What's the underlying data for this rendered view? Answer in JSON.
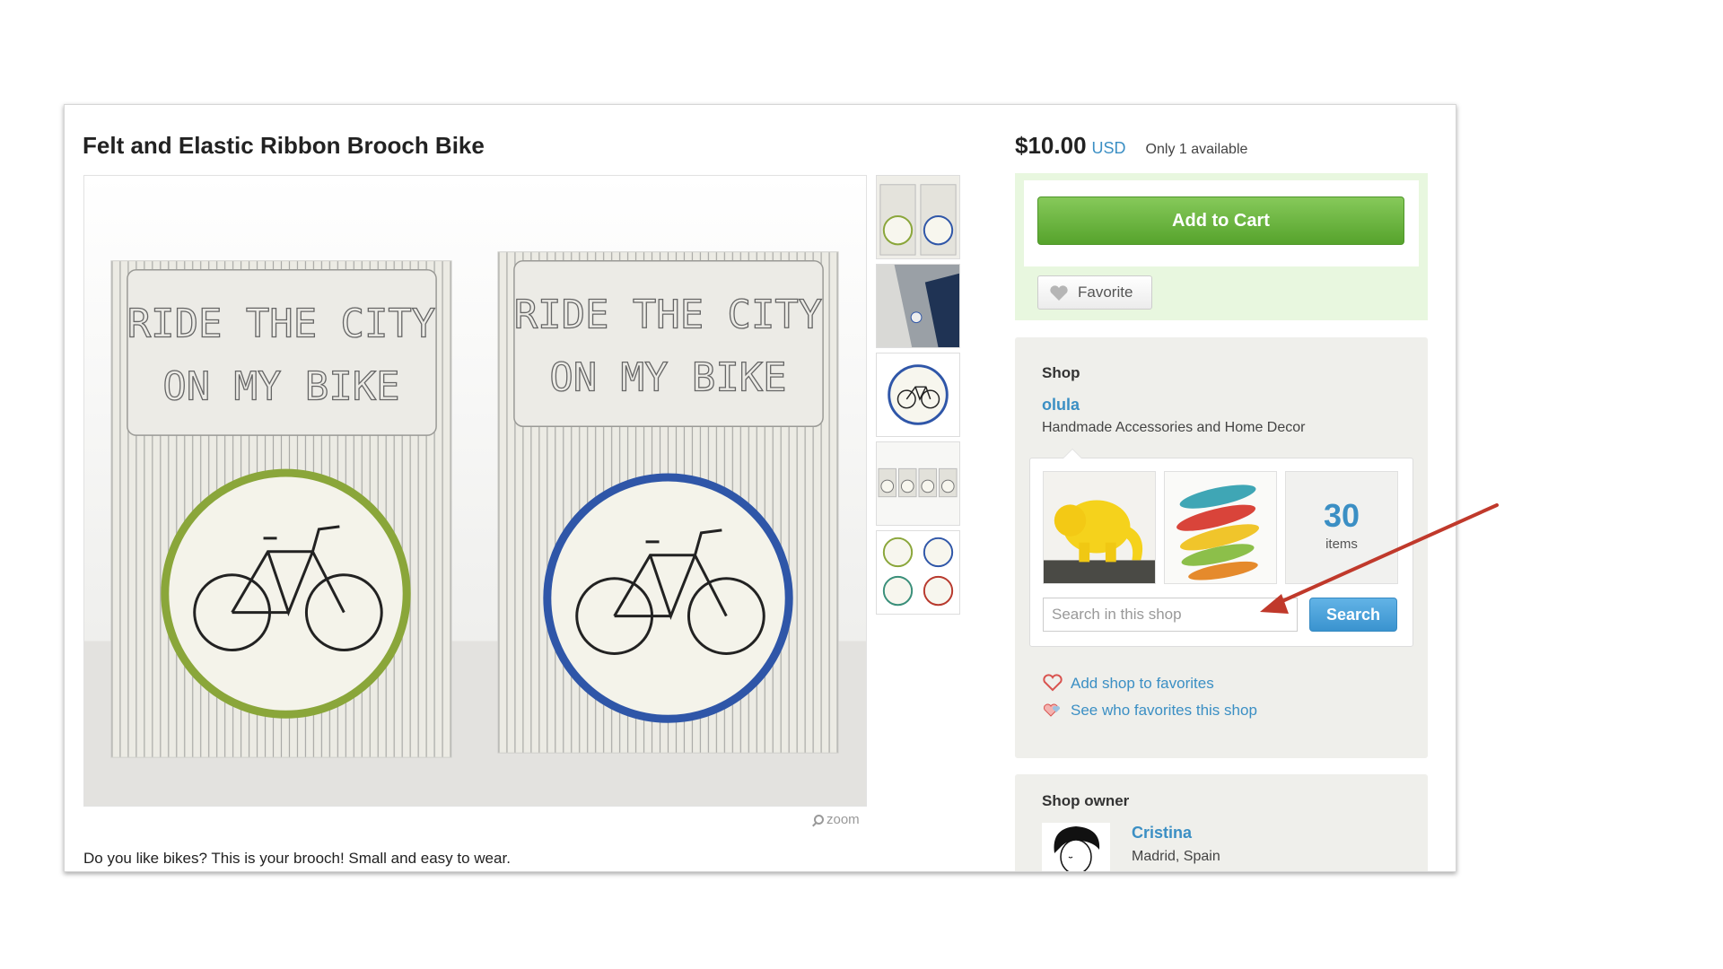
{
  "listing": {
    "title": "Felt and Elastic Ribbon Brooch Bike",
    "description": "Do you like bikes? This is your brooch! Small and easy to wear.",
    "zoom_label": "zoom",
    "image_text_line1": "RIDE THE CITY",
    "image_text_line2": "ON MY BIKE",
    "brooch_colors": [
      "#8aa63a",
      "#2f56a8"
    ]
  },
  "purchase": {
    "price": "$10.00",
    "currency": "USD",
    "availability": "Only 1 available",
    "add_to_cart_label": "Add to Cart",
    "favorite_label": "Favorite"
  },
  "shop": {
    "heading": "Shop",
    "name": "olula",
    "tagline": "Handmade Accessories and Home Decor",
    "items_count": "30",
    "items_label": "items",
    "search_placeholder": "Search in this shop",
    "search_button": "Search",
    "add_favorites_link": "Add shop to favorites",
    "see_favorites_link": "See who favorites this shop"
  },
  "owner": {
    "heading": "Shop owner",
    "name": "Cristina",
    "location": "Madrid, Spain"
  },
  "colors": {
    "link_blue": "#3b8fc4",
    "cart_green": "#5aa82f",
    "annotation_red": "#c0392b"
  }
}
